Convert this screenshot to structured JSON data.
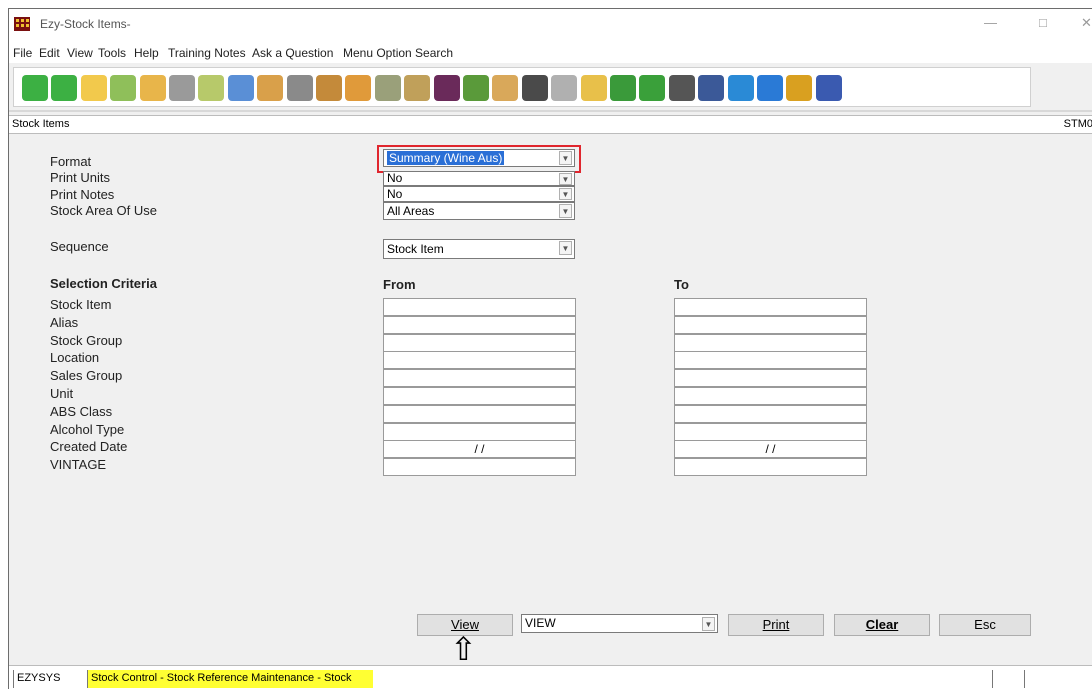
{
  "window": {
    "title": "Ezy-Stock Items-",
    "minimize": "—",
    "maximize": "□",
    "close": "✕"
  },
  "menu": [
    "File",
    "Edit",
    "View",
    "Tools",
    "Help",
    "Training Notes",
    "Ask a Question",
    "Menu Option Search"
  ],
  "toolbar_icons": [
    {
      "name": "back-arrow-icon",
      "color": "#3cb043"
    },
    {
      "name": "forward-arrow-icon",
      "color": "#3cb043"
    },
    {
      "name": "folder-icon",
      "color": "#f2c94c"
    },
    {
      "name": "invoice-icon",
      "color": "#8fbf5a"
    },
    {
      "name": "money-hand-icon",
      "color": "#e8b54a"
    },
    {
      "name": "bank-icon",
      "color": "#9a9a9a"
    },
    {
      "name": "tag-icon",
      "color": "#b7c96a"
    },
    {
      "name": "calculator-icon",
      "color": "#5a8fd6"
    },
    {
      "name": "people-icon",
      "color": "#d9a04a"
    },
    {
      "name": "pen-icon",
      "color": "#8a8a8a"
    },
    {
      "name": "barrel-icon",
      "color": "#c48a3a"
    },
    {
      "name": "box-icon",
      "color": "#e09a3a"
    },
    {
      "name": "hammer-icon",
      "color": "#9aa07a"
    },
    {
      "name": "truck-icon",
      "color": "#c0a05a"
    },
    {
      "name": "wine-bottle-icon",
      "color": "#6a2a5a"
    },
    {
      "name": "grapes-icon",
      "color": "#5a9a3a"
    },
    {
      "name": "briefcase-icon",
      "color": "#d9a85a"
    },
    {
      "name": "gear-icon",
      "color": "#4a4a4a"
    },
    {
      "name": "cylinder-icon",
      "color": "#b0b0b0"
    },
    {
      "name": "cube-icon",
      "color": "#e8c04a"
    },
    {
      "name": "shamrock-icon",
      "color": "#3a9a3a"
    },
    {
      "name": "dollar-icon",
      "color": "#3aa03a"
    },
    {
      "name": "news-icon",
      "color": "#555555"
    },
    {
      "name": "facebook-icon",
      "color": "#3b5998"
    },
    {
      "name": "globe-icon",
      "color": "#2a8ad6"
    },
    {
      "name": "info-icon",
      "color": "#2a7ad6"
    },
    {
      "name": "exit-door-icon",
      "color": "#d9a020"
    },
    {
      "name": "help-icon",
      "color": "#3a5ab0"
    }
  ],
  "subheader": {
    "title": "Stock Items",
    "code": "STM0"
  },
  "form": {
    "format_label": "Format",
    "format_value": "Summary (Wine Aus)",
    "print_units_label": "Print Units",
    "print_units_value": "No",
    "print_notes_label": "Print Notes",
    "print_notes_value": "No",
    "area_label": "Stock Area Of Use",
    "area_value": "All Areas",
    "sequence_label": "Sequence",
    "sequence_value": "Stock Item"
  },
  "criteria": {
    "heading": "Selection Criteria",
    "from_label": "From",
    "to_label": "To",
    "rows": [
      {
        "label": "Stock Item",
        "from": "",
        "to": ""
      },
      {
        "label": "Alias",
        "from": "",
        "to": ""
      },
      {
        "label": "Stock Group",
        "from": "",
        "to": ""
      },
      {
        "label": "Location",
        "from": "",
        "to": ""
      },
      {
        "label": "Sales Group",
        "from": "",
        "to": ""
      },
      {
        "label": "Unit",
        "from": "",
        "to": ""
      },
      {
        "label": "ABS Class",
        "from": "",
        "to": ""
      },
      {
        "label": "Alcohol Type",
        "from": "",
        "to": ""
      },
      {
        "label": "Created Date",
        "from": "/ /",
        "to": "/ /"
      },
      {
        "label": "VINTAGE",
        "from": "",
        "to": ""
      }
    ]
  },
  "actions": {
    "view": "View",
    "output_value": "VIEW",
    "print": "Print",
    "clear": "Clear",
    "esc": "Esc",
    "pointer_arrow": "⇧"
  },
  "status": {
    "user": "EZYSYS",
    "path": "Stock Control - Stock Reference Maintenance - Stock Items"
  }
}
